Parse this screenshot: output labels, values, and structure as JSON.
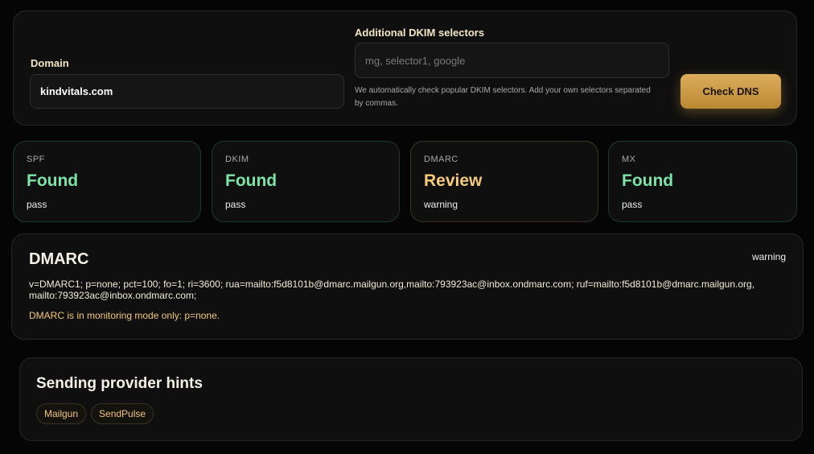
{
  "form": {
    "domain_label": "Domain",
    "domain_value": "kindvitals.com",
    "dkim_label": "Additional DKIM selectors",
    "dkim_placeholder": "mg, selector1, google",
    "dkim_hint": "We automatically check popular DKIM selectors. Add your own selectors separated by commas.",
    "check_button": "Check DNS"
  },
  "cards": [
    {
      "title": "SPF",
      "status": "Found",
      "sub": "pass",
      "tone": "ok"
    },
    {
      "title": "DKIM",
      "status": "Found",
      "sub": "pass",
      "tone": "ok"
    },
    {
      "title": "DMARC",
      "status": "Review",
      "sub": "warning",
      "tone": "warn"
    },
    {
      "title": "MX",
      "status": "Found",
      "sub": "pass",
      "tone": "ok"
    }
  ],
  "dmarc": {
    "title": "DMARC",
    "status": "warning",
    "record": "v=DMARC1; p=none; pct=100; fo=1; ri=3600; rua=mailto:f5d8101b@dmarc.mailgun.org,mailto:793923ac@inbox.ondmarc.com; ruf=mailto:f5d8101b@dmarc.mailgun.org,mailto:793923ac@inbox.ondmarc.com;",
    "note": "DMARC is in monitoring mode only: p=none."
  },
  "hints": {
    "title": "Sending provider hints",
    "providers": [
      "Mailgun",
      "SendPulse"
    ]
  },
  "colors": {
    "accent": "#d4a24e",
    "ok": "#7de3a6",
    "warn": "#f5cb7a",
    "background": "#050505"
  }
}
